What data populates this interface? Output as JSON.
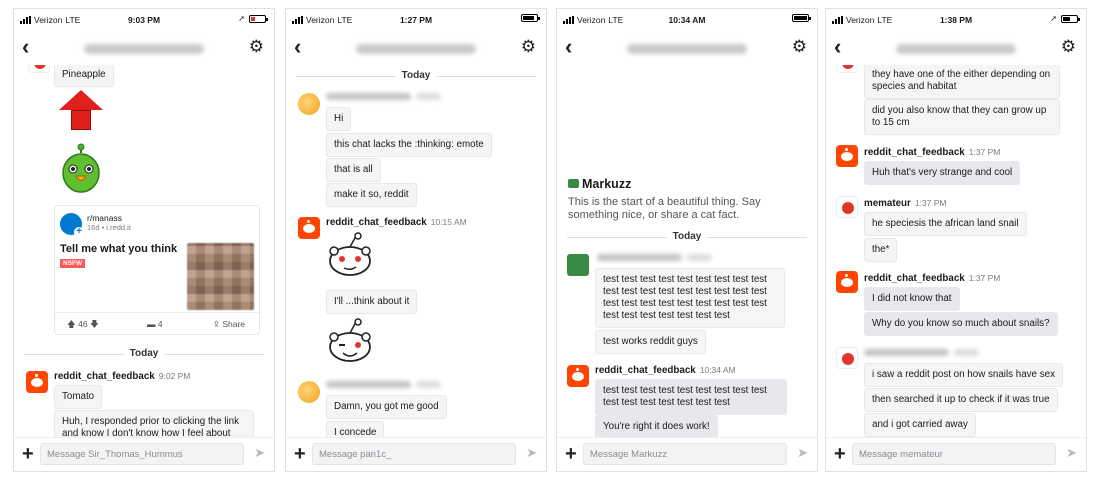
{
  "phones": [
    {
      "carrier": "Verizon",
      "network": "LTE",
      "time": "9:03 PM",
      "input_placeholder": "Message Sir_Thomas_Hummus",
      "pineapple": "Pineapple",
      "post": {
        "subreddit": "r/manass",
        "meta": "16d • i.redd.it",
        "title": "Tell me what you think",
        "nsfw": "NSFW",
        "votes": "46",
        "comments": "4",
        "share": "Share"
      },
      "divider": "Today",
      "sender": "reddit_chat_feedback",
      "sender_time": "9:02 PM",
      "messages": [
        "Tomato",
        "Huh, I responded prior to clicking the link and know I don't know how I feel about my response"
      ]
    },
    {
      "carrier": "Verizon",
      "network": "LTE",
      "time": "1:27 PM",
      "input_placeholder": "Message pan1c_",
      "divider": "Today",
      "messages_a": [
        "Hi",
        "this chat lacks the :thinking: emote",
        "that is all",
        "make it so, reddit"
      ],
      "sender": "reddit_chat_feedback",
      "sender_time": "10:15 AM",
      "messages_b": [
        "I'll ...think about it"
      ],
      "messages_c": [
        "Damn, you got me good",
        "I concede"
      ]
    },
    {
      "carrier": "Verizon",
      "network": "LTE",
      "time": "10:34 AM",
      "input_placeholder": "Message Markuzz",
      "intro_name": "Markuzz",
      "intro_text": "This is the start of a beautiful thing. Say something nice, or share a cat fact.",
      "divider": "Today",
      "messages_a": [
        "test test test test test test test test test test test test test test test test test test test test test test test test test test test test test test test test test test",
        "test works reddit guys"
      ],
      "sender": "reddit_chat_feedback",
      "sender_time": "10:34 AM",
      "messages_b": [
        "test test test test test test test test test test test test test test test test",
        "You're right it does work!"
      ]
    },
    {
      "carrier": "Verizon",
      "network": "LTE",
      "time": "1:38 PM",
      "input_placeholder": "Message memateur",
      "messages_a": [
        "they have one of the either depending on species and habitat",
        "did you also know that they can grow up to 15 cm"
      ],
      "sender1": "reddit_chat_feedback",
      "sender1_time": "1:37 PM",
      "messages_b": [
        "Huh that's very strange and cool"
      ],
      "sender2": "memateur",
      "sender2_time": "1:37 PM",
      "messages_c": [
        "he speciesis the african land snail",
        "the*"
      ],
      "sender3": "reddit_chat_feedback",
      "sender3_time": "1:37 PM",
      "messages_d": [
        "I did not know that",
        "Why do you know so much about snails?"
      ],
      "messages_e": [
        "i saw a reddit post on how snails have sex",
        "then searched it up to check if it was true",
        "and i got carried away"
      ]
    }
  ]
}
